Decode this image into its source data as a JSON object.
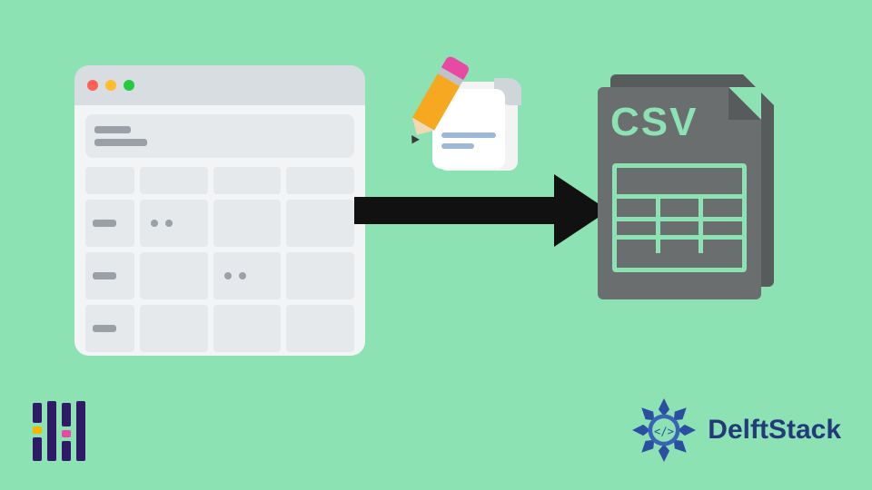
{
  "csv_label": "CSV",
  "brand_text": "DelftStack",
  "icons": {
    "spreadsheet": "spreadsheet-window-icon",
    "arrow": "arrow-right-icon",
    "notepad": "notepad-pencil-icon",
    "csv": "csv-file-icon",
    "pandas": "pandas-logo-icon",
    "delft": "delftstack-logo-icon"
  },
  "colors": {
    "background": "#8de2b4",
    "csv_fill": "#6a6e6f",
    "brand_navy": "#233a7a"
  }
}
